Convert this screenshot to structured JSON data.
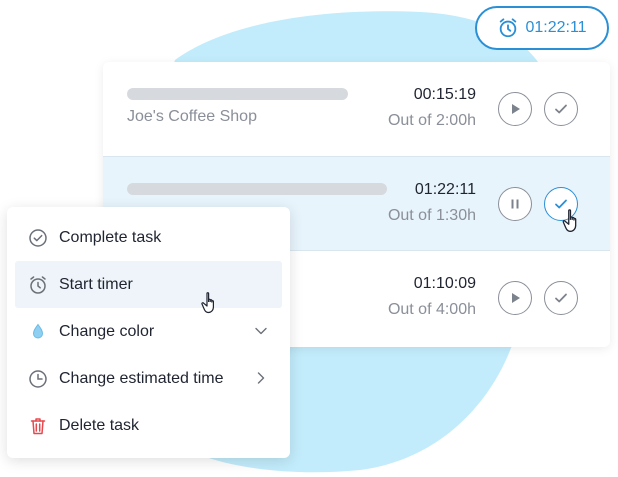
{
  "timer_pill": {
    "time": "01:22:11",
    "icon": "alarm-clock-icon"
  },
  "tasks": [
    {
      "name_visible": "",
      "name": "Joe's Coffee Shop",
      "time": "00:15:19",
      "estimate": "Out of 2:00h",
      "state": "stopped"
    },
    {
      "name_visible": "",
      "name": "",
      "time": "01:22:11",
      "estimate": "Out of 1:30h",
      "state": "running"
    },
    {
      "name_visible": "",
      "name": "",
      "time": "01:10:09",
      "estimate": "Out of 4:00h",
      "state": "stopped"
    }
  ],
  "context_menu": {
    "items": [
      {
        "label": "Complete task",
        "icon": "check-circle-icon"
      },
      {
        "label": "Start timer",
        "icon": "alarm-clock-icon",
        "highlighted": true
      },
      {
        "label": "Change color",
        "icon": "droplet-icon",
        "trailing": "chevron-down-icon"
      },
      {
        "label": "Change estimated time",
        "icon": "clock-icon",
        "trailing": "chevron-right-icon"
      },
      {
        "label": "Delete task",
        "icon": "trash-icon"
      }
    ]
  },
  "colors": {
    "accent": "#2b8fd6",
    "blob": "#c2ecfb",
    "selected_row": "#e8f4fc",
    "danger": "#e5484d"
  }
}
